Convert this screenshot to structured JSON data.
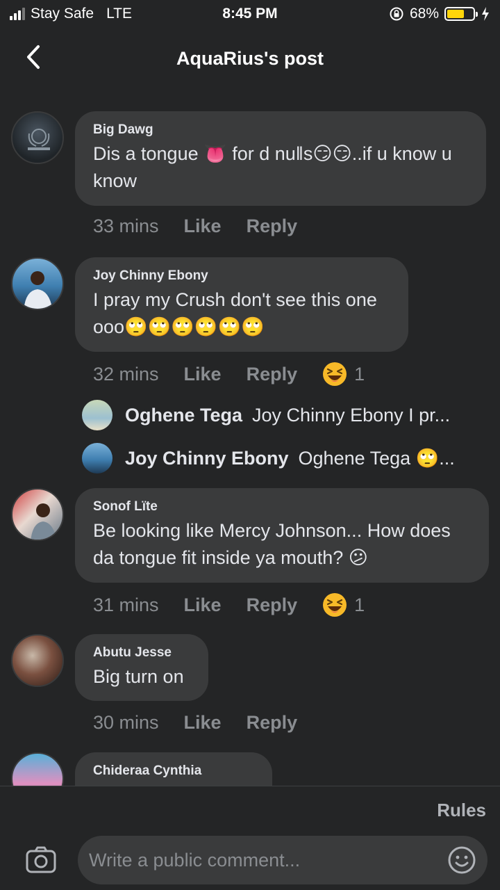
{
  "status": {
    "carrier": "Stay Safe",
    "network": "LTE",
    "time": "8:45 PM",
    "battery": "68%",
    "battery_level": 0.68
  },
  "header": {
    "title": "AquaRius's post"
  },
  "comments": [
    {
      "author": "Big Dawg",
      "text": "Dis a tongue 👅 for d nu‖s😏😏..if u know u know",
      "time": "33 mins",
      "like": "Like",
      "reply": "Reply"
    },
    {
      "author": "Joy Chinny Ebony",
      "text": "I pray my Crush don't see this one ooo🙄🙄🙄🙄🙄🙄",
      "time": "32 mins",
      "like": "Like",
      "reply": "Reply",
      "reaction_count": "1"
    },
    {
      "author": "Sonof Lïte",
      "text": "Be looking like Mercy Johnson... How does da tongue fit inside ya mouth? 😕",
      "time": "31 mins",
      "like": "Like",
      "reply": "Reply",
      "reaction_count": "1"
    },
    {
      "author": "Abutu Jesse",
      "text": "Big turn on",
      "time": "30 mins",
      "like": "Like",
      "reply": "Reply"
    },
    {
      "author": "Chideraa Cynthia"
    }
  ],
  "replies": [
    {
      "author": "Oghene Tega",
      "text": "Joy Chinny Ebony  I pr..."
    },
    {
      "author": "Joy Chinny Ebony",
      "text": "Oghene Tega  🙄..."
    }
  ],
  "footer": {
    "rules": "Rules",
    "placeholder": "Write a public comment..."
  },
  "colors": {
    "background": "#242526",
    "bubble": "#3a3b3c",
    "meta": "#8a8d91",
    "battery": "#ffd60a"
  }
}
